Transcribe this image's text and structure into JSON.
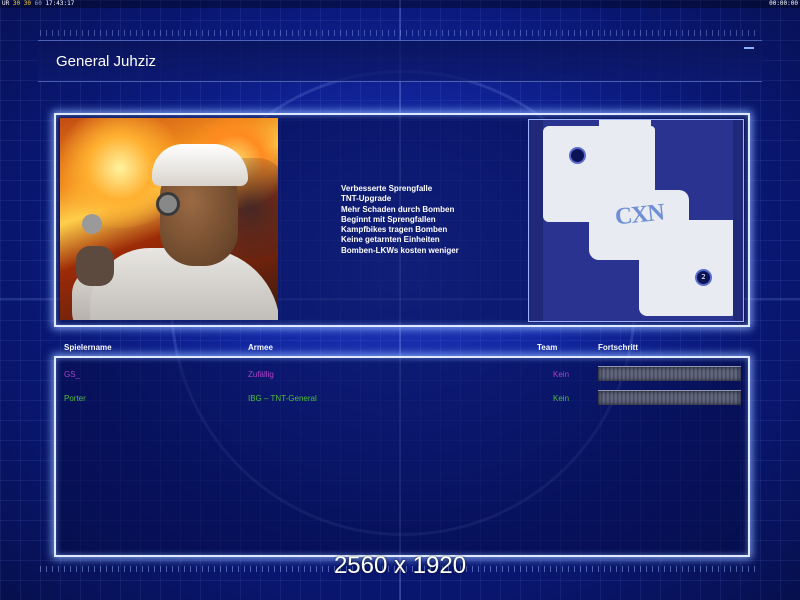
{
  "status_bar": {
    "left_prefix": "UR",
    "left_num1": "30",
    "left_num2": "30",
    "left_num3": "60",
    "left_time": "17:43:17",
    "right_time": "00:00:00"
  },
  "header": {
    "title": "General Juhziz"
  },
  "general": {
    "portrait_icon": "general-portrait",
    "features": [
      "Verbesserte Sprengfalle",
      "TNT-Upgrade",
      "Mehr Schaden durch Bomben",
      "Beginnt mit Sprengfallen",
      "Kampfbikes tragen Bomben",
      "Keine getarnten Einheiten",
      "Bomben-LKWs kosten weniger"
    ]
  },
  "minimap": {
    "logo_text": "CXN",
    "start_1_label": "",
    "start_2_label": "2"
  },
  "players": {
    "columns": {
      "name": "Spielername",
      "army": "Armee",
      "team": "Team",
      "progress": "Fortschritt"
    },
    "rows": [
      {
        "name": "GS_",
        "army": "Zufällig",
        "team": "Kein",
        "color": "#b040c8"
      },
      {
        "name": "Porter",
        "army": "IBG – TNT-General",
        "team": "Kein",
        "color": "#4fbf3a"
      }
    ]
  },
  "caption": {
    "resolution": "2560 x 1920"
  },
  "colors": {
    "background": "#1226a0",
    "frame_glow": "#dfe8ff",
    "player1": "#b040c8",
    "player2": "#4fbf3a"
  }
}
